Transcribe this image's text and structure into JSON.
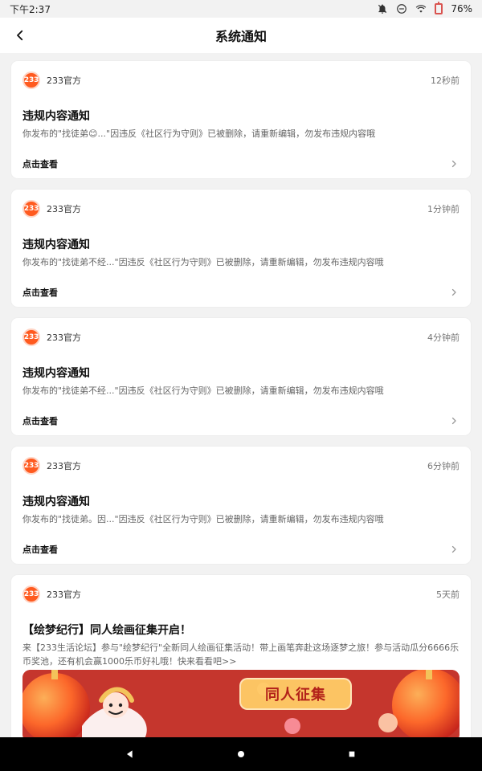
{
  "statusbar": {
    "time": "下午2:37",
    "battery": "76%",
    "icons": [
      "mute-icon",
      "dnd-icon",
      "wifi-icon",
      "battery-icon"
    ]
  },
  "header": {
    "title": "系统通知"
  },
  "notifications": [
    {
      "author": "233官方",
      "time": "12秒前",
      "title": "违规内容通知",
      "body": "你发布的\"找徒弟😊...\"因违反《社区行为守则》已被删除，请重新编辑，勿发布违规内容哦",
      "action": "点击查看"
    },
    {
      "author": "233官方",
      "time": "1分钟前",
      "title": "违规内容通知",
      "body": "你发布的\"找徒弟不经...\"因违反《社区行为守则》已被删除，请重新编辑，勿发布违规内容哦",
      "action": "点击查看"
    },
    {
      "author": "233官方",
      "time": "4分钟前",
      "title": "违规内容通知",
      "body": "你发布的\"找徒弟不经...\"因违反《社区行为守则》已被删除，请重新编辑，勿发布违规内容哦",
      "action": "点击查看"
    },
    {
      "author": "233官方",
      "time": "6分钟前",
      "title": "违规内容通知",
      "body": "你发布的\"找徒弟。因...\"因违反《社区行为守则》已被删除，请重新编辑，勿发布违规内容哦",
      "action": "点击查看"
    }
  ],
  "promo": {
    "author": "233官方",
    "time": "5天前",
    "title": "【绘梦纪行】同人绘画征集开启！",
    "desc": "来【233生活论坛】参与\"绘梦纪行\"全新同人绘画征集活动！带上画笔奔赴这场逐梦之旅！参与活动瓜分6666乐币奖池，还有机会赢1000乐币好礼哦！快来看看吧>>",
    "banner_text": "同人征集"
  },
  "colors": {
    "logo": "#ff5a1f",
    "banner": "#c5362d"
  },
  "navbar": {
    "buttons": [
      "back-nav-icon",
      "home-nav-icon",
      "recents-nav-icon"
    ]
  }
}
